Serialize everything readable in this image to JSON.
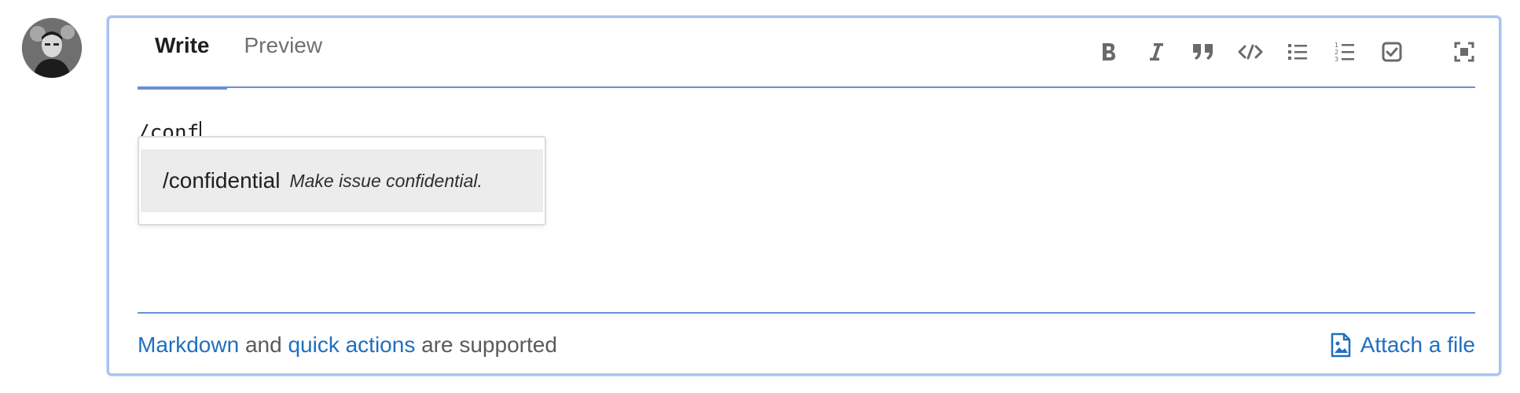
{
  "avatar": {
    "alt": "User avatar"
  },
  "tabs": [
    {
      "label": "Write",
      "active": true
    },
    {
      "label": "Preview",
      "active": false
    }
  ],
  "toolbar": {
    "icons": [
      "bold-icon",
      "italic-icon",
      "quote-icon",
      "code-icon",
      "bullet-list-icon",
      "numbered-list-icon",
      "checklist-icon",
      "fullscreen-icon"
    ]
  },
  "editor": {
    "text": "/conf"
  },
  "autocomplete": {
    "items": [
      {
        "command": "/confidential",
        "description": "Make issue confidential."
      }
    ]
  },
  "footer": {
    "markdown_link": "Markdown",
    "and_text": " and ",
    "quick_actions_link": "quick actions",
    "supported_text": " are supported",
    "attach_label": "Attach a file"
  },
  "colors": {
    "accent": "#6b8fd6",
    "link": "#1f6fbf",
    "border": "#a7c3f0"
  }
}
